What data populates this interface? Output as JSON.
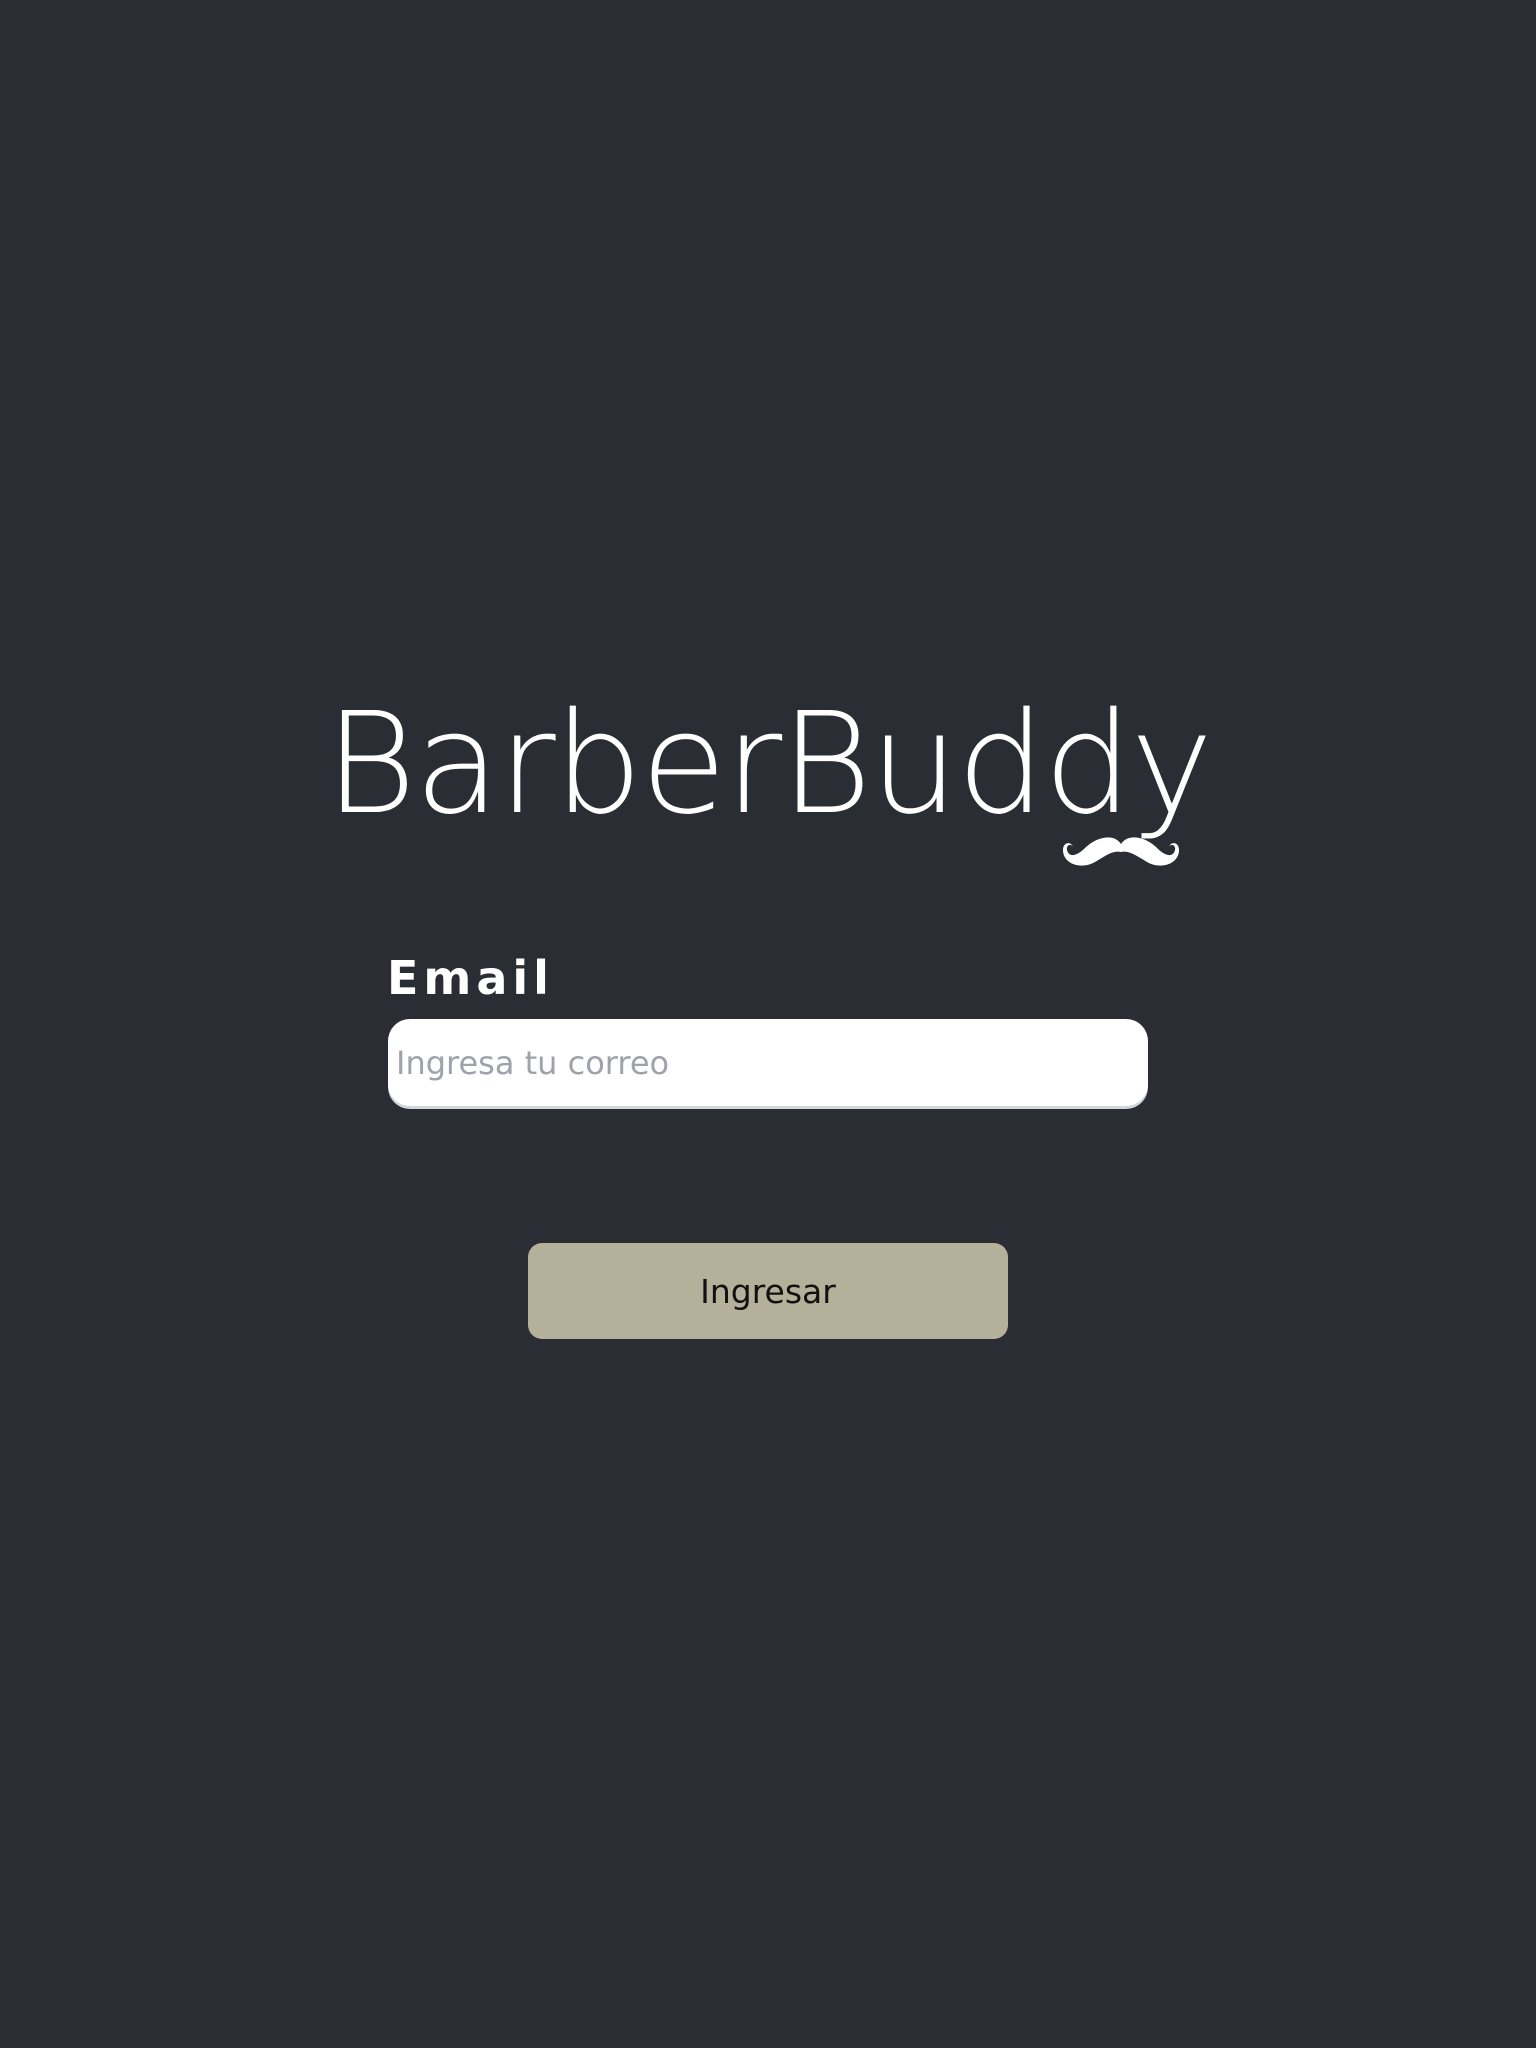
{
  "app": {
    "title": "BarberBuddy",
    "logo_icon": "mustache-icon"
  },
  "form": {
    "email_label": "Email",
    "email_placeholder": "Ingresa tu correo",
    "email_value": "",
    "submit_label": "Ingresar"
  },
  "colors": {
    "background": "#2a2d33",
    "text": "#ffffff",
    "button": "#b5b09a",
    "placeholder": "#9ea2aa"
  }
}
